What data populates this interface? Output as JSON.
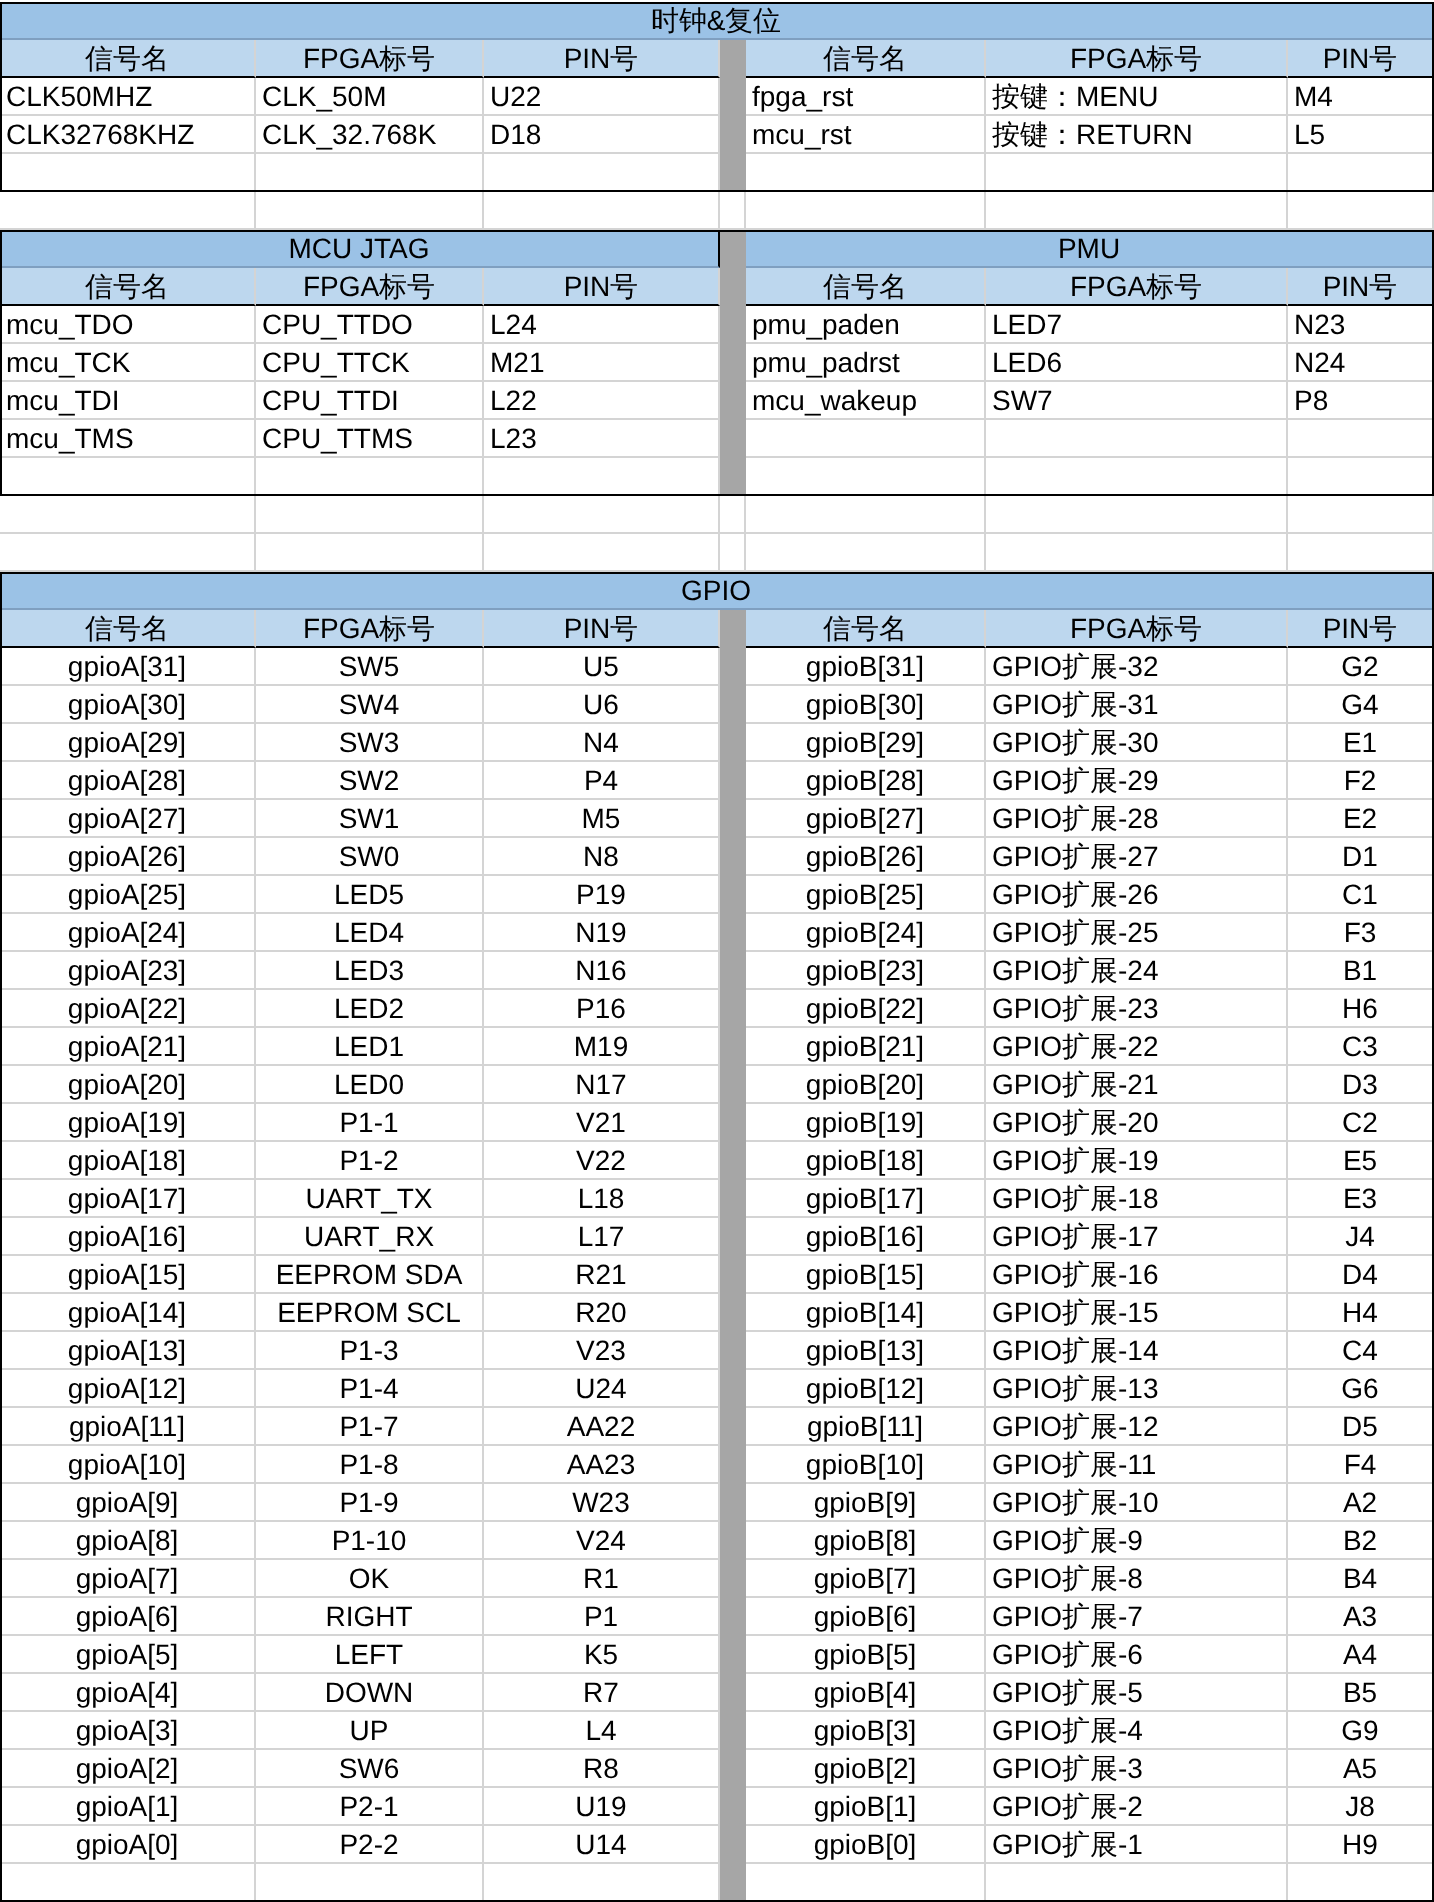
{
  "sections": [
    {
      "kind": "plain",
      "titles": [
        "时钟&复位"
      ],
      "left": {
        "columns": [
          "信号名",
          "FPGA标号",
          "PIN号"
        ],
        "rows": [
          [
            "CLK50MHZ",
            "CLK_50M",
            "U22"
          ],
          [
            "CLK32768KHZ",
            "CLK_32.768K",
            "D18"
          ]
        ]
      },
      "right": {
        "columns": [
          "信号名",
          "FPGA标号",
          "PIN号"
        ],
        "rows": [
          [
            "fpga_rst",
            "按键：MENU",
            "M4"
          ],
          [
            "mcu_rst",
            "按键：RETURN",
            "L5"
          ]
        ]
      }
    },
    {
      "kind": "plain",
      "titles": [
        "MCU JTAG",
        "PMU"
      ],
      "left": {
        "columns": [
          "信号名",
          "FPGA标号",
          "PIN号"
        ],
        "rows": [
          [
            "mcu_TDO",
            "CPU_TTDO",
            "L24"
          ],
          [
            "mcu_TCK",
            "CPU_TTCK",
            "M21"
          ],
          [
            "mcu_TDI",
            "CPU_TTDI",
            "L22"
          ],
          [
            "mcu_TMS",
            "CPU_TTMS",
            "L23"
          ]
        ]
      },
      "right": {
        "columns": [
          "信号名",
          "FPGA标号",
          "PIN号"
        ],
        "rows": [
          [
            "pmu_paden",
            "LED7",
            "N23"
          ],
          [
            "pmu_padrst",
            "LED6",
            "N24"
          ],
          [
            "mcu_wakeup",
            "SW7",
            "P8"
          ]
        ]
      }
    },
    {
      "kind": "centered",
      "titles": [
        "GPIO"
      ],
      "left": {
        "columns": [
          "信号名",
          "FPGA标号",
          "PIN号"
        ],
        "rows": [
          [
            "gpioA[31]",
            "SW5",
            "U5"
          ],
          [
            "gpioA[30]",
            "SW4",
            "U6"
          ],
          [
            "gpioA[29]",
            "SW3",
            "N4"
          ],
          [
            "gpioA[28]",
            "SW2",
            "P4"
          ],
          [
            "gpioA[27]",
            "SW1",
            "M5"
          ],
          [
            "gpioA[26]",
            "SW0",
            "N8"
          ],
          [
            "gpioA[25]",
            "LED5",
            "P19"
          ],
          [
            "gpioA[24]",
            "LED4",
            "N19"
          ],
          [
            "gpioA[23]",
            "LED3",
            "N16"
          ],
          [
            "gpioA[22]",
            "LED2",
            "P16"
          ],
          [
            "gpioA[21]",
            "LED1",
            "M19"
          ],
          [
            "gpioA[20]",
            "LED0",
            "N17"
          ],
          [
            "gpioA[19]",
            "P1-1",
            "V21"
          ],
          [
            "gpioA[18]",
            "P1-2",
            "V22"
          ],
          [
            "gpioA[17]",
            "UART_TX",
            "L18"
          ],
          [
            "gpioA[16]",
            "UART_RX",
            "L17"
          ],
          [
            "gpioA[15]",
            "EEPROM SDA",
            "R21"
          ],
          [
            "gpioA[14]",
            "EEPROM SCL",
            "R20"
          ],
          [
            "gpioA[13]",
            "P1-3",
            "V23"
          ],
          [
            "gpioA[12]",
            "P1-4",
            "U24"
          ],
          [
            "gpioA[11]",
            "P1-7",
            "AA22"
          ],
          [
            "gpioA[10]",
            "P1-8",
            "AA23"
          ],
          [
            "gpioA[9]",
            "P1-9",
            "W23"
          ],
          [
            "gpioA[8]",
            "P1-10",
            "V24"
          ],
          [
            "gpioA[7]",
            "OK",
            "R1"
          ],
          [
            "gpioA[6]",
            "RIGHT",
            "P1"
          ],
          [
            "gpioA[5]",
            "LEFT",
            "K5"
          ],
          [
            "gpioA[4]",
            "DOWN",
            "R7"
          ],
          [
            "gpioA[3]",
            "UP",
            "L4"
          ],
          [
            "gpioA[2]",
            "SW6",
            "R8"
          ],
          [
            "gpioA[1]",
            "P2-1",
            "U19"
          ],
          [
            "gpioA[0]",
            "P2-2",
            "U14"
          ]
        ]
      },
      "right": {
        "columns": [
          "信号名",
          "FPGA标号",
          "PIN号"
        ],
        "rows": [
          [
            "gpioB[31]",
            "GPIO扩展-32",
            "G2"
          ],
          [
            "gpioB[30]",
            "GPIO扩展-31",
            "G4"
          ],
          [
            "gpioB[29]",
            "GPIO扩展-30",
            "E1"
          ],
          [
            "gpioB[28]",
            "GPIO扩展-29",
            "F2"
          ],
          [
            "gpioB[27]",
            "GPIO扩展-28",
            "E2"
          ],
          [
            "gpioB[26]",
            "GPIO扩展-27",
            "D1"
          ],
          [
            "gpioB[25]",
            "GPIO扩展-26",
            "C1"
          ],
          [
            "gpioB[24]",
            "GPIO扩展-25",
            "F3"
          ],
          [
            "gpioB[23]",
            "GPIO扩展-24",
            "B1"
          ],
          [
            "gpioB[22]",
            "GPIO扩展-23",
            "H6"
          ],
          [
            "gpioB[21]",
            "GPIO扩展-22",
            "C3"
          ],
          [
            "gpioB[20]",
            "GPIO扩展-21",
            "D3"
          ],
          [
            "gpioB[19]",
            "GPIO扩展-20",
            "C2"
          ],
          [
            "gpioB[18]",
            "GPIO扩展-19",
            "E5"
          ],
          [
            "gpioB[17]",
            "GPIO扩展-18",
            "E3"
          ],
          [
            "gpioB[16]",
            "GPIO扩展-17",
            "J4"
          ],
          [
            "gpioB[15]",
            "GPIO扩展-16",
            "D4"
          ],
          [
            "gpioB[14]",
            "GPIO扩展-15",
            "H4"
          ],
          [
            "gpioB[13]",
            "GPIO扩展-14",
            "C4"
          ],
          [
            "gpioB[12]",
            "GPIO扩展-13",
            "G6"
          ],
          [
            "gpioB[11]",
            "GPIO扩展-12",
            "D5"
          ],
          [
            "gpioB[10]",
            "GPIO扩展-11",
            "F4"
          ],
          [
            "gpioB[9]",
            "GPIO扩展-10",
            "A2"
          ],
          [
            "gpioB[8]",
            "GPIO扩展-9",
            "B2"
          ],
          [
            "gpioB[7]",
            "GPIO扩展-8",
            "B4"
          ],
          [
            "gpioB[6]",
            "GPIO扩展-7",
            "A3"
          ],
          [
            "gpioB[5]",
            "GPIO扩展-6",
            "A4"
          ],
          [
            "gpioB[4]",
            "GPIO扩展-5",
            "B5"
          ],
          [
            "gpioB[3]",
            "GPIO扩展-4",
            "G9"
          ],
          [
            "gpioB[2]",
            "GPIO扩展-3",
            "A5"
          ],
          [
            "gpioB[1]",
            "GPIO扩展-2",
            "J8"
          ],
          [
            "gpioB[0]",
            "GPIO扩展-1",
            "H9"
          ]
        ]
      }
    }
  ]
}
